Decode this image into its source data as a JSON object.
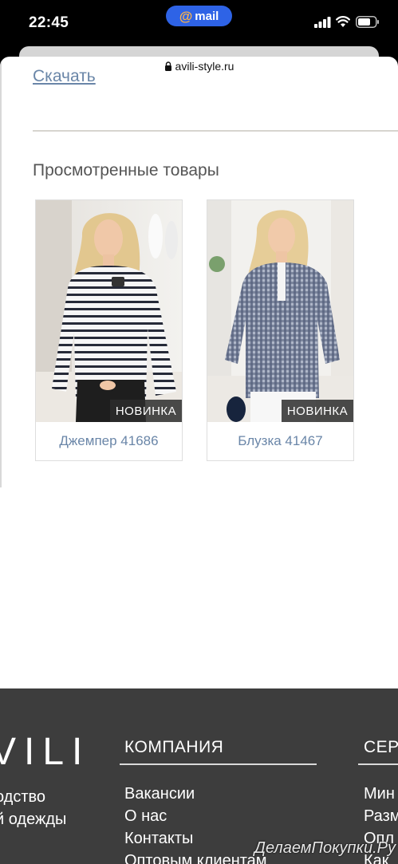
{
  "status_bar": {
    "time": "22:45",
    "mail_label": "mail",
    "mail_icon": "@"
  },
  "browser": {
    "url": "avili-style.ru"
  },
  "content": {
    "download_link": "Скачать",
    "viewed_title": "Просмотренные товары",
    "products": [
      {
        "name": "Джемпер 41686",
        "badge": "НОВИНКА"
      },
      {
        "name": "Блузка 41467",
        "badge": "НОВИНКА"
      }
    ]
  },
  "footer": {
    "logo": "VILI",
    "tagline": [
      "одство",
      "й одежды"
    ],
    "company_heading": "КОМПАНИЯ",
    "company_links": [
      "Вакансии",
      "О нас",
      "Контакты",
      "Оптовым клиентам"
    ],
    "service_heading": "СЕР",
    "service_links": [
      "Мин",
      "Разм",
      "Опл",
      "Как"
    ]
  },
  "watermark": "ДелаемПокупки.Ру",
  "colors": {
    "link": "#6a86a8",
    "footer_bg": "#3d3d3d",
    "mail_pill": "#2e63e6",
    "badge_bg": "#2d2d2d"
  }
}
